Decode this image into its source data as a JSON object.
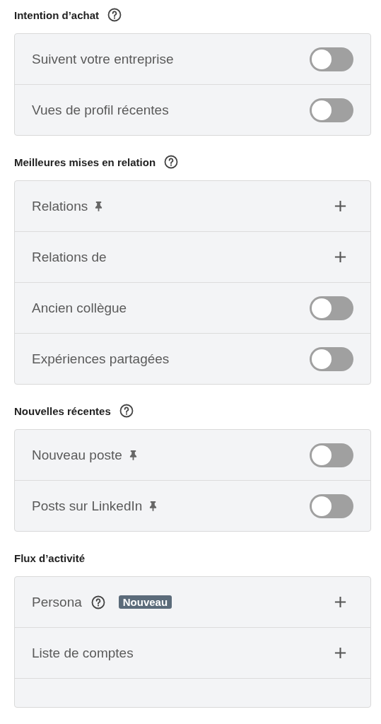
{
  "sections": [
    {
      "title": "Intention d’achat",
      "help": true,
      "rows": [
        {
          "kind": "toggle",
          "label": "Suivent votre entreprise",
          "on": false
        },
        {
          "kind": "toggle",
          "label": "Vues de profil récentes",
          "on": false
        }
      ]
    },
    {
      "title": "Meilleures mises en relation",
      "help": true,
      "rows": [
        {
          "kind": "add",
          "label": "Relations",
          "pinned": true
        },
        {
          "kind": "add",
          "label": "Relations de"
        },
        {
          "kind": "toggle",
          "label": "Ancien collègue",
          "on": false
        },
        {
          "kind": "toggle",
          "label": "Expériences partagées",
          "on": false
        }
      ]
    },
    {
      "title": "Nouvelles récentes",
      "help": true,
      "rows": [
        {
          "kind": "toggle",
          "label": "Nouveau poste",
          "on": false,
          "pinned": true
        },
        {
          "kind": "toggle",
          "label": "Posts sur LinkedIn",
          "on": false,
          "pinned": true
        }
      ]
    },
    {
      "title": "Flux d’activité",
      "help": false,
      "cut": true,
      "rows": [
        {
          "kind": "add",
          "label": "Persona",
          "help": true,
          "badge": "Nouveau"
        },
        {
          "kind": "add",
          "label": "Liste de comptes"
        }
      ]
    }
  ]
}
